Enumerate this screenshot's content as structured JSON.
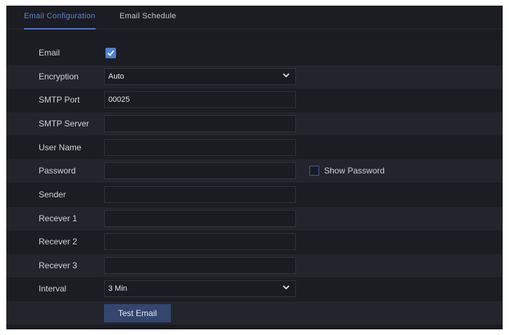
{
  "tabs": [
    {
      "label": "Email Configuration",
      "active": true
    },
    {
      "label": "Email Schedule",
      "active": false
    }
  ],
  "form": {
    "email": {
      "label": "Email",
      "checked": true
    },
    "encryption": {
      "label": "Encryption",
      "value": "Auto"
    },
    "smtp_port": {
      "label": "SMTP Port",
      "value": "00025"
    },
    "smtp_server": {
      "label": "SMTP Server",
      "value": ""
    },
    "user_name": {
      "label": "User Name",
      "value": ""
    },
    "password": {
      "label": "Password",
      "value": "",
      "show_password_label": "Show Password",
      "show_password_checked": false
    },
    "sender": {
      "label": "Sender",
      "value": ""
    },
    "receiver1": {
      "label": "Recever 1",
      "value": ""
    },
    "receiver2": {
      "label": "Recever 2",
      "value": ""
    },
    "receiver3": {
      "label": "Recever 3",
      "value": ""
    },
    "interval": {
      "label": "Interval",
      "value": "3 Min"
    },
    "test_email_label": "Test Email"
  },
  "colors": {
    "accent": "#4f7fd6",
    "panel_bg": "#1a1c22",
    "row_light": "#22252c",
    "button_bg": "#33466f"
  }
}
